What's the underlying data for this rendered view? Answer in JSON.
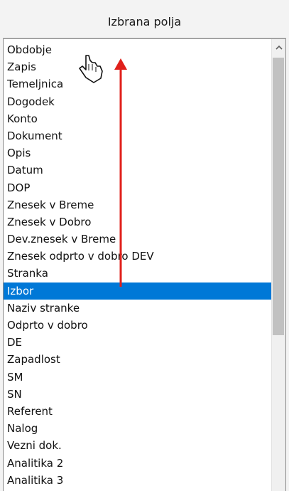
{
  "header": {
    "title": "Izbrana polja"
  },
  "list": {
    "items": [
      "Obdobje",
      "Zapis",
      "Temeljnica",
      "Dogodek",
      "Konto",
      "Dokument",
      "Opis",
      "Datum",
      "DOP",
      "Znesek v Breme",
      "Znesek v Dobro",
      "Dev.znesek v Breme",
      "Znesek odprto v dobro DEV",
      "Stranka",
      "Izbor",
      "Naziv stranke",
      "Odprto v dobro",
      "DE",
      "Zapadlost",
      "SM",
      "SN",
      "Referent",
      "Nalog",
      "Vezni dok.",
      "Analitika 2",
      "Analitika 3"
    ],
    "selected": "Izbor"
  },
  "scrollbar": {
    "up_icon": "chevron-up-icon"
  },
  "overlay": {
    "arrow_icon": "red-arrow-up-icon",
    "cursor_icon": "hand-cursor-icon",
    "arrow_color": "#e0201b"
  },
  "colors": {
    "selection": "#0078d7",
    "header_bg": "#f3f3f3",
    "list_bg": "#ffffff"
  }
}
